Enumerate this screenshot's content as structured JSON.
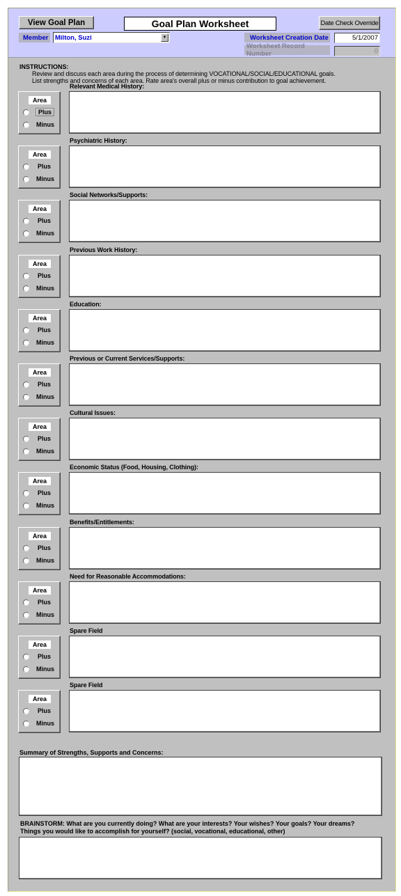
{
  "header": {
    "view_goal_plan_label": "View Goal Plan",
    "title": "Goal Plan Worksheet",
    "date_check_override_label": "Date Check Override",
    "member_label": "Member",
    "member_value": "Milton, Suzi",
    "creation_date_label": "Worksheet Creation Date",
    "creation_date_value": "5/1/2007",
    "record_number_label": "Worksheet Record Number",
    "record_number_value": "0"
  },
  "instructions": {
    "heading": "INSTRUCTIONS:",
    "line1": "Review and discuss each area during the process of determining VOCATIONAL/SOCIAL/EDUCATIONAL goals.",
    "line2": "List strengths and concerns of each area.  Rate area's overall plus or minus contribution to goal achievement."
  },
  "area_box": {
    "title": "Area",
    "plus_label": "Plus",
    "minus_label": "Minus"
  },
  "sections": [
    {
      "label": "Relevant Medical History:",
      "value": "",
      "rating": null
    },
    {
      "label": "Psychiatric History:",
      "value": "",
      "rating": null
    },
    {
      "label": "Social Networks/Supports:",
      "value": "",
      "rating": null
    },
    {
      "label": "Previous Work History:",
      "value": "",
      "rating": null
    },
    {
      "label": "Education:",
      "value": "",
      "rating": null
    },
    {
      "label": "Previous or Current Services/Supports:",
      "value": "",
      "rating": null
    },
    {
      "label": "Cultural Issues:",
      "value": "",
      "rating": null
    },
    {
      "label": "Economic Status  (Food, Housing, Clothing):",
      "value": "",
      "rating": null
    },
    {
      "label": "Benefits/Entitlements:",
      "value": "",
      "rating": null
    },
    {
      "label": "Need for Reasonable Accommodations:",
      "value": "",
      "rating": null
    },
    {
      "label": "Spare Field",
      "value": "",
      "rating": null
    },
    {
      "label": "Spare Field",
      "value": "",
      "rating": null
    }
  ],
  "summary": {
    "label": "Summary of Strengths, Supports and Concerns:",
    "value": ""
  },
  "brainstorm": {
    "label_line1": "BRAINSTORM:  What are you currently doing?  What are your interests?  Your wishes?  Your goals?  Your dreams?",
    "label_line2": "Things you would like to accomplish for yourself?  (social, vocational, educational, other)",
    "value": ""
  }
}
